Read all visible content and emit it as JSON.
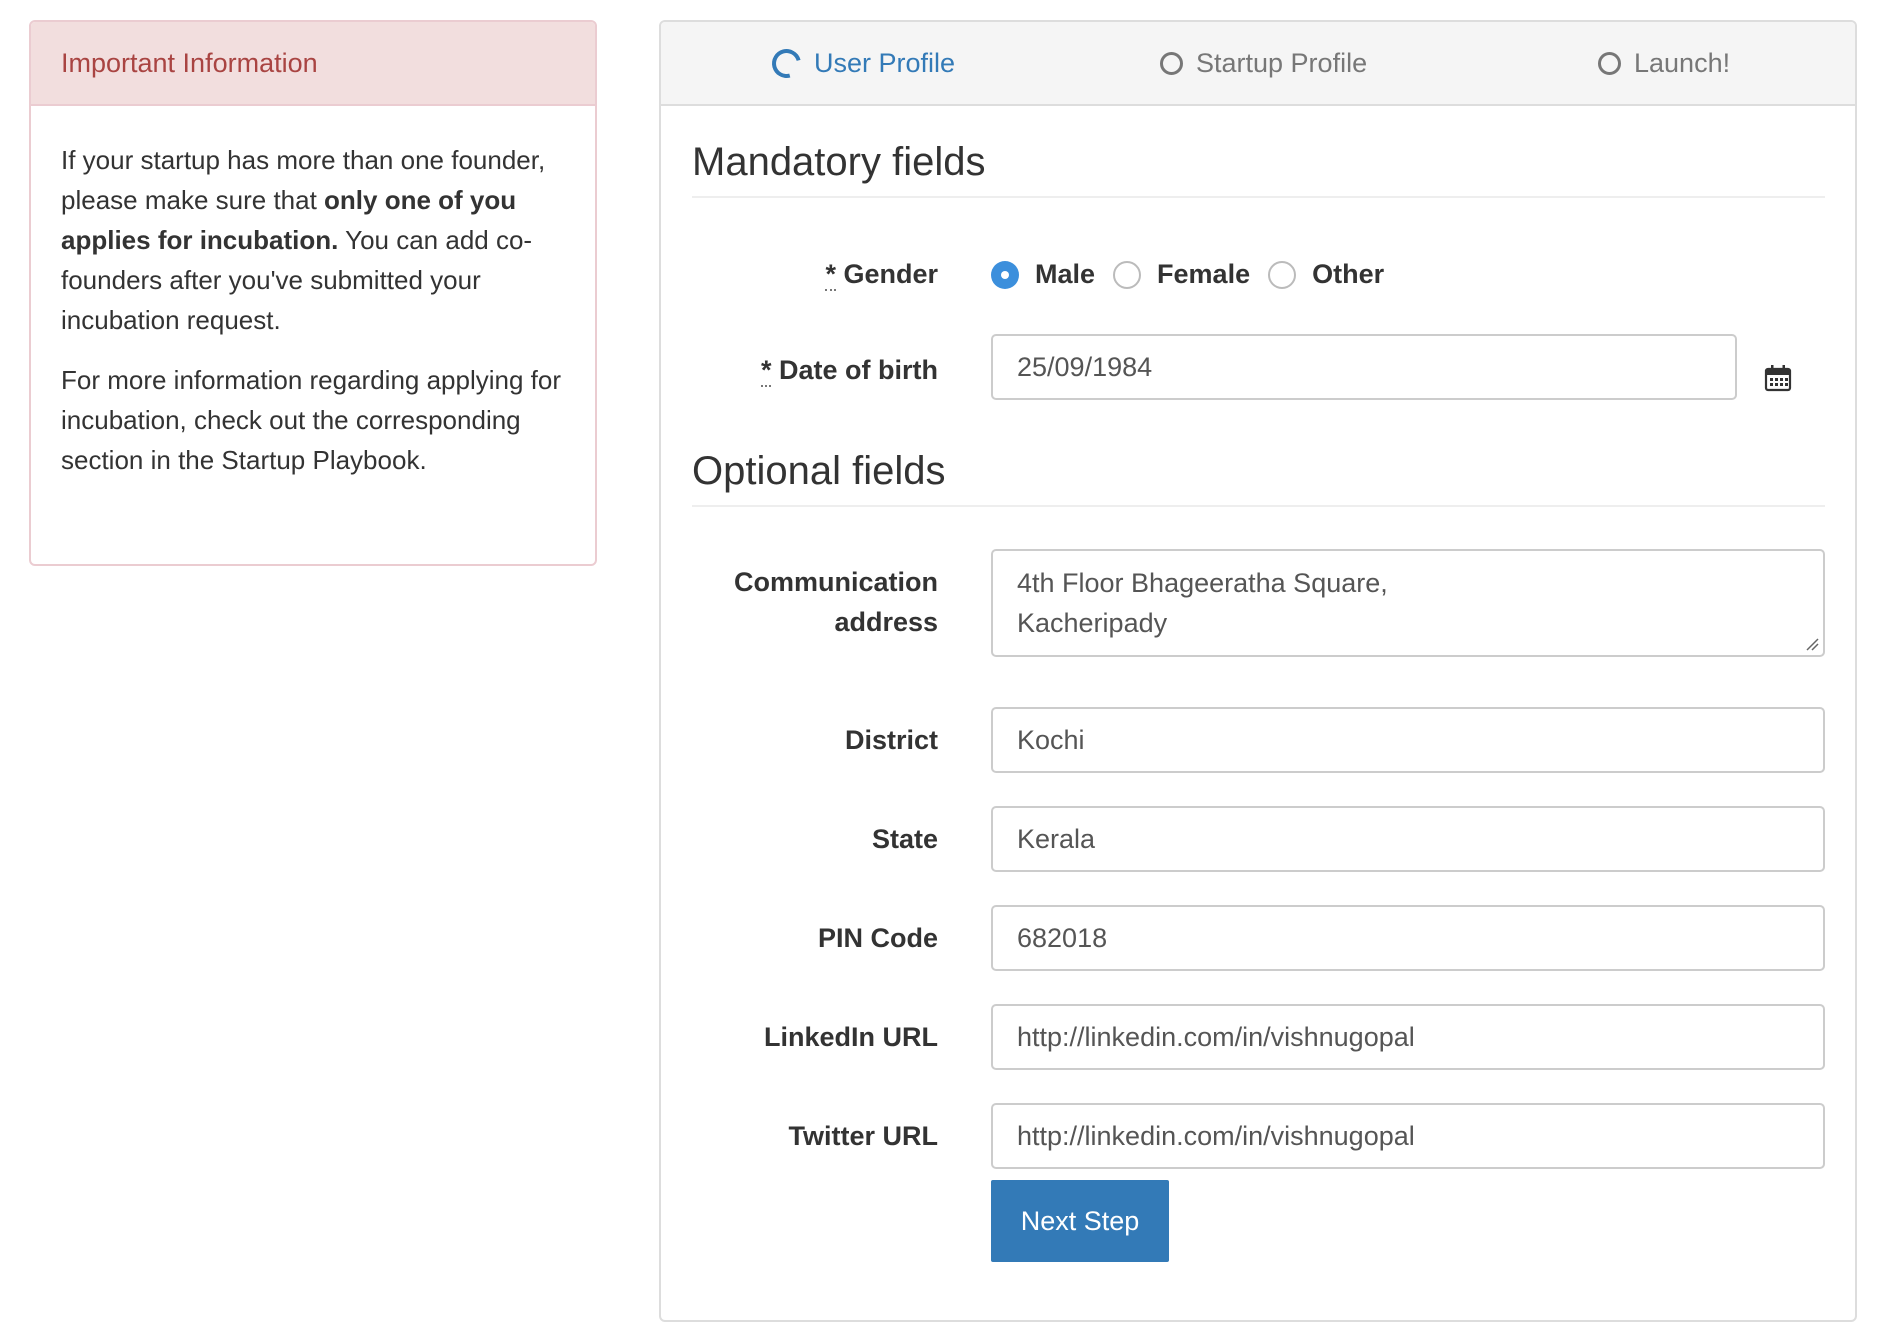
{
  "info": {
    "title": "Important Information",
    "para1_part1": "If your startup has more than one founder, please make sure that ",
    "para1_bold": "only one of you applies for incubation.",
    "para1_part2": " You can add co-founders after you've submitted your incubation request.",
    "para2": "For more information regarding applying for incubation, check out the corresponding section in the Startup Playbook."
  },
  "steps": [
    {
      "label": "User Profile",
      "state": "active"
    },
    {
      "label": "Startup Profile",
      "state": "pending"
    },
    {
      "label": "Launch!",
      "state": "pending"
    }
  ],
  "mandatory": {
    "title": "Mandatory fields",
    "gender_label": "Gender",
    "gender_options": [
      "Male",
      "Female",
      "Other"
    ],
    "gender_selected": "Male",
    "dob_label": "Date of birth",
    "dob_value": "25/09/1984",
    "required_marker": "*"
  },
  "optional": {
    "title": "Optional fields",
    "address_label_line1": "Communication",
    "address_label_line2": "address",
    "address_line1": "4th Floor Bhageeratha Square,",
    "address_line2": "Kacheripady",
    "district_label": "District",
    "district_value": "Kochi",
    "state_label": "State",
    "state_value": "Kerala",
    "pin_label": "PIN Code",
    "pin_value": "682018",
    "linkedin_label": "LinkedIn URL",
    "linkedin_value": "http://linkedin.com/in/vishnugopal",
    "twitter_label": "Twitter URL",
    "twitter_value": "http://linkedin.com/in/vishnugopal"
  },
  "buttons": {
    "next_label": "Next Step"
  },
  "colors": {
    "primary": "#337ab7",
    "danger_text": "#a94442",
    "danger_bg": "#f2dede",
    "danger_border": "#ebccd1"
  },
  "icons": {
    "calendar": "calendar-icon",
    "step_active": "spinner-ring-icon",
    "step_pending": "circle-outline-icon"
  }
}
